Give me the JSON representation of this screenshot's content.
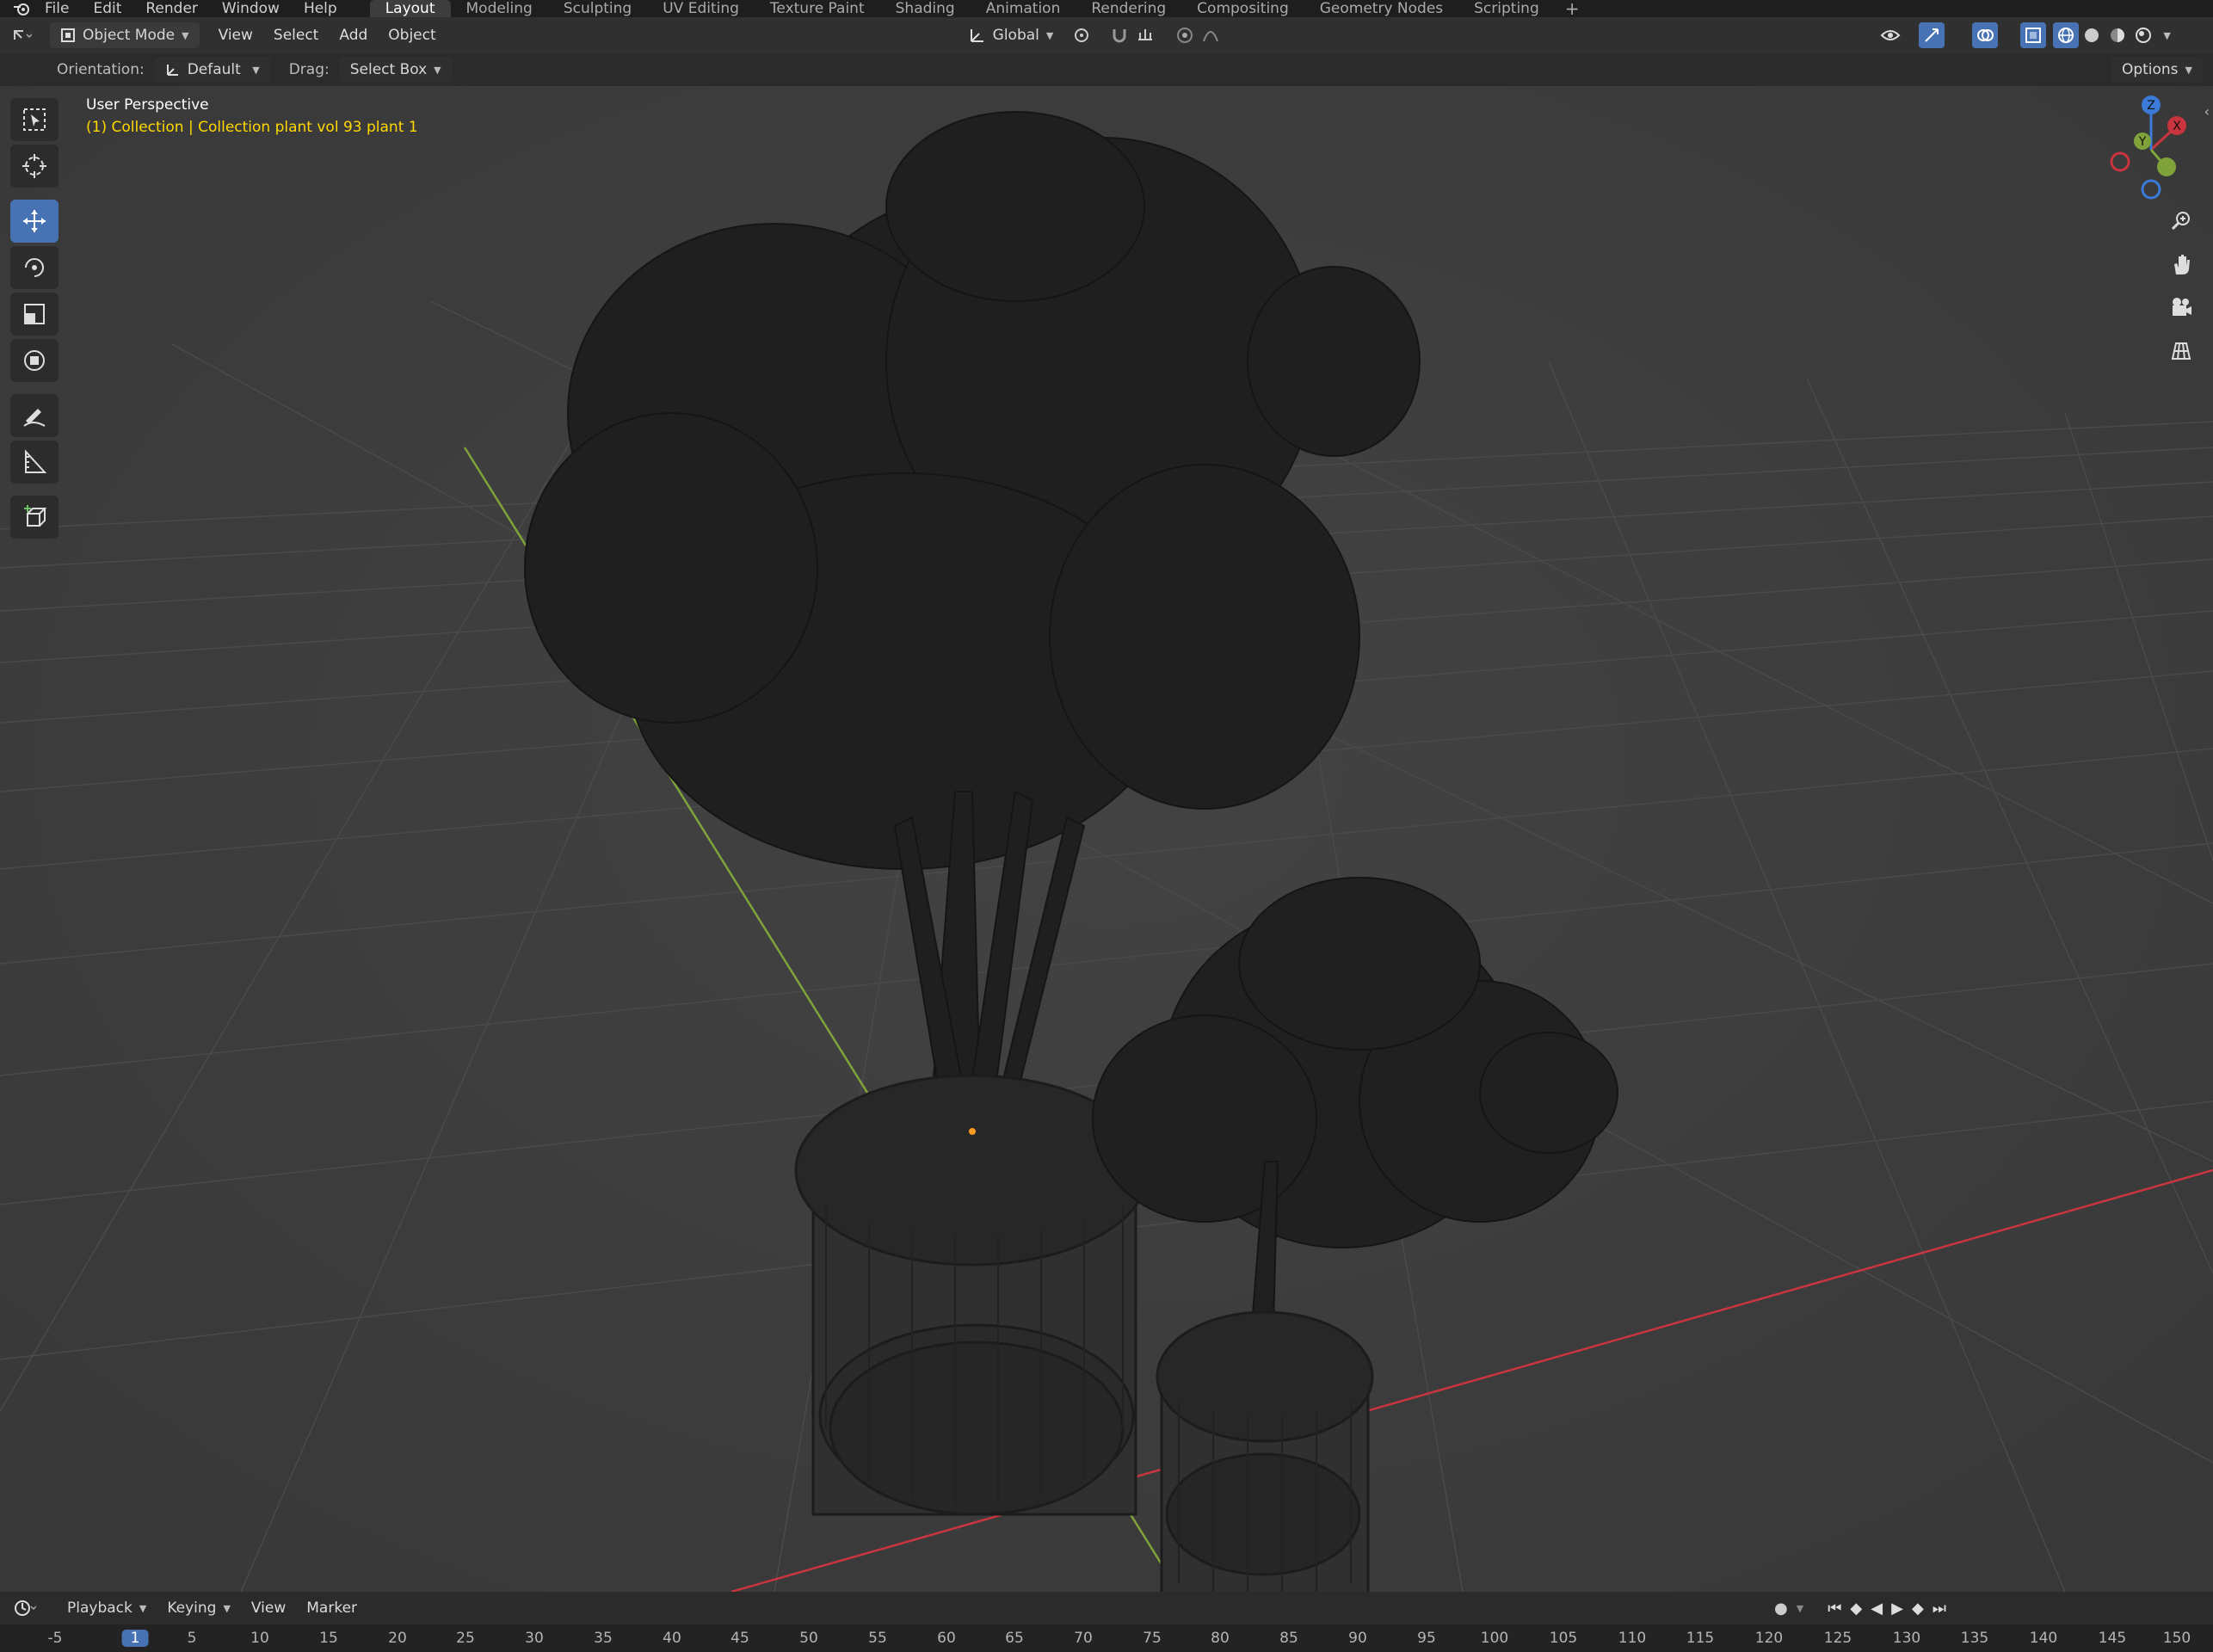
{
  "topbar": {
    "menus": [
      "File",
      "Edit",
      "Render",
      "Window",
      "Help"
    ],
    "workspaces": [
      "Layout",
      "Modeling",
      "Sculpting",
      "UV Editing",
      "Texture Paint",
      "Shading",
      "Animation",
      "Rendering",
      "Compositing",
      "Geometry Nodes",
      "Scripting"
    ],
    "active_workspace": "Layout",
    "add_tab": "+"
  },
  "header": {
    "mode": "Object Mode",
    "menus": [
      "View",
      "Select",
      "Add",
      "Object"
    ],
    "transform_orientation": "Global",
    "options": "Options"
  },
  "tool_settings": {
    "orientation_label": "Orientation:",
    "orientation_value": "Default",
    "drag_label": "Drag:",
    "drag_value": "Select Box"
  },
  "viewport": {
    "view_name": "User Perspective",
    "collection_info": "(1) Collection | Collection plant vol 93 plant 1",
    "gizmo": {
      "x": "X",
      "y": "Y",
      "z": "Z"
    },
    "tools": [
      "select-box",
      "cursor",
      "move",
      "rotate",
      "scale",
      "transform",
      "annotate",
      "measure",
      "add-cube"
    ],
    "active_tool": "move"
  },
  "timeline": {
    "menus": [
      "Playback",
      "Keying",
      "View",
      "Marker"
    ],
    "current_frame": "1",
    "ruler_labels": [
      "-5",
      "1",
      "5",
      "10",
      "15",
      "20",
      "25",
      "30",
      "35",
      "40",
      "45",
      "50",
      "55",
      "60",
      "65",
      "70",
      "75",
      "80",
      "85",
      "90",
      "95",
      "100",
      "105",
      "110",
      "115",
      "120",
      "125",
      "130",
      "135",
      "140",
      "145",
      "150"
    ]
  },
  "colors": {
    "accent": "#4772b3",
    "x_axis": "#c8353f",
    "y_axis": "#7fa33a",
    "z_axis": "#3b7ad6",
    "collection_text": "#ffd800"
  }
}
